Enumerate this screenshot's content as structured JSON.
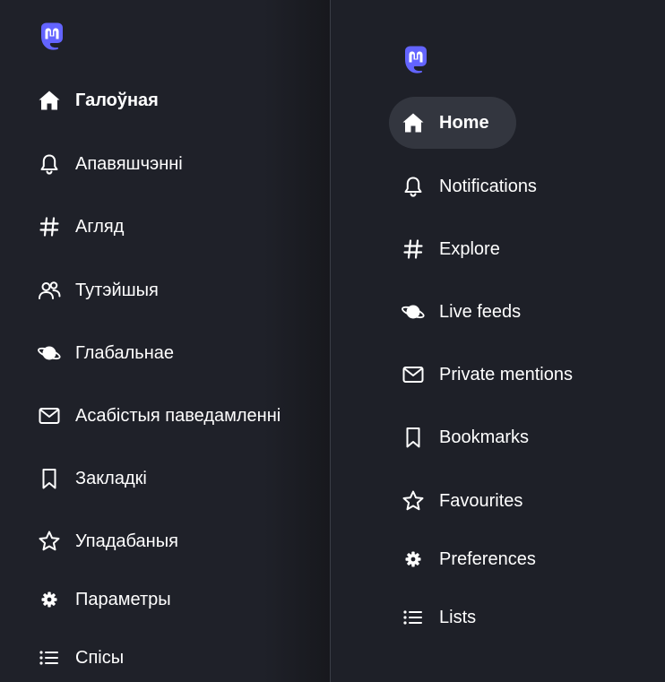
{
  "colors": {
    "background": "#1e2028",
    "active_item_bg": "#33363f",
    "brand": "#6364ff",
    "divider": "#3a3d46",
    "text": "#ffffff"
  },
  "left_panel": {
    "language": "be",
    "logo_icon": "mastodon-logo",
    "items": [
      {
        "label": "Галоўная",
        "icon": "home-icon",
        "active": true
      },
      {
        "label": "Апавяшчэнні",
        "icon": "bell-icon",
        "active": false
      },
      {
        "label": "Агляд",
        "icon": "hashtag-icon",
        "active": false
      },
      {
        "label": "Тутэйшыя",
        "icon": "users-icon",
        "active": false
      },
      {
        "label": "Глабальнае",
        "icon": "planet-icon",
        "active": false
      },
      {
        "label": "Асабістыя паведамленні",
        "icon": "envelope-icon",
        "active": false
      },
      {
        "label": "Закладкі",
        "icon": "bookmark-icon",
        "active": false
      },
      {
        "label": "Упадабаныя",
        "icon": "star-icon",
        "active": false
      },
      {
        "label": "Параметры",
        "icon": "gear-icon",
        "active": false
      },
      {
        "label": "Спісы",
        "icon": "list-icon",
        "active": false
      }
    ]
  },
  "right_panel": {
    "language": "en",
    "logo_icon": "mastodon-logo",
    "items": [
      {
        "label": "Home",
        "icon": "home-icon",
        "active": true
      },
      {
        "label": "Notifications",
        "icon": "bell-icon",
        "active": false
      },
      {
        "label": "Explore",
        "icon": "hashtag-icon",
        "active": false
      },
      {
        "label": "Live feeds",
        "icon": "planet-icon",
        "active": false
      },
      {
        "label": "Private mentions",
        "icon": "envelope-icon",
        "active": false
      },
      {
        "label": "Bookmarks",
        "icon": "bookmark-icon",
        "active": false
      },
      {
        "label": "Favourites",
        "icon": "star-icon",
        "active": false
      },
      {
        "label": "Preferences",
        "icon": "gear-icon",
        "active": false
      },
      {
        "label": "Lists",
        "icon": "list-icon",
        "active": false
      }
    ]
  }
}
